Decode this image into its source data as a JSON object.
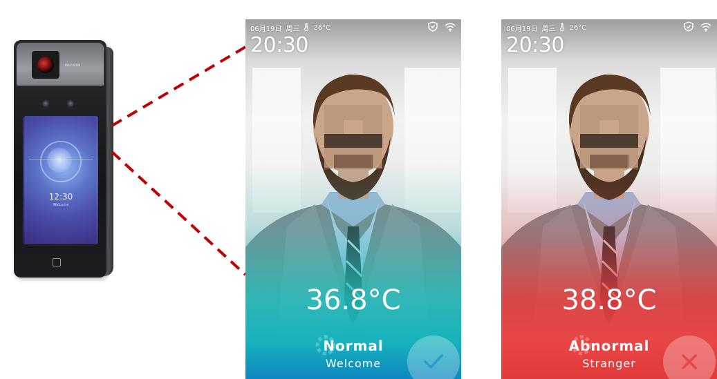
{
  "device": {
    "brand_text": "HIKVISION",
    "screen_time": "12:30",
    "screen_subtext": "Welcome"
  },
  "status_bar": {
    "date": "06月19日",
    "weekday": "周三",
    "weather": "26°C"
  },
  "clock": "20:30",
  "screens": [
    {
      "id": "normal",
      "temperature": "36.8°C",
      "status": "Normal",
      "message": "Welcome",
      "result_icon": "check-icon",
      "accent_color": "#16b2bd"
    },
    {
      "id": "abnormal",
      "temperature": "38.8°C",
      "status": "Abnormal",
      "message": "Stranger",
      "result_icon": "cross-icon",
      "accent_color": "#e94545"
    }
  ],
  "icons": {
    "thermometer": "thermometer-icon",
    "shield": "shield-icon",
    "wifi": "wifi-icon"
  },
  "callout_color": "#c00000"
}
